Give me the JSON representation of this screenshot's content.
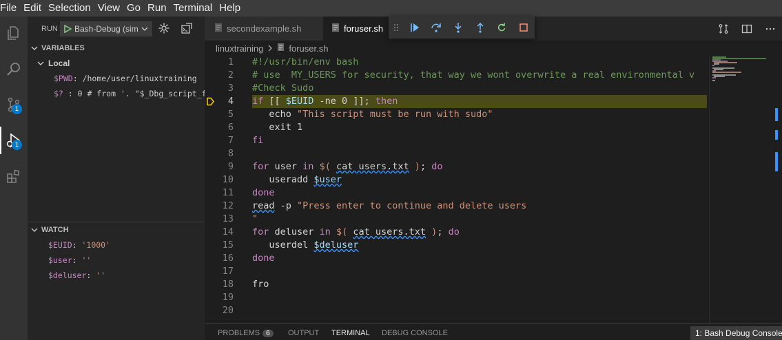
{
  "menu": [
    "File",
    "Edit",
    "Selection",
    "View",
    "Go",
    "Run",
    "Terminal",
    "Help"
  ],
  "activity": {
    "scm_badge": "1",
    "debug_badge": "1"
  },
  "run": {
    "label": "RUN",
    "config": "Bash-Debug (simp"
  },
  "variables": {
    "header": "VARIABLES",
    "scope": "Local",
    "items": [
      {
        "name": "$PWD",
        "value": "/home/user/linuxtraining"
      },
      {
        "name": "$?",
        "value": "0 # from '. \"$_Dbg_script_f"
      }
    ]
  },
  "watch": {
    "header": "WATCH",
    "items": [
      {
        "name": "$EUID",
        "value": "'1000'"
      },
      {
        "name": "$user",
        "value": "''"
      },
      {
        "name": "$deluser",
        "value": "''"
      }
    ]
  },
  "tabs": [
    {
      "label": "secondexample.sh",
      "active": false
    },
    {
      "label": "foruser.sh",
      "active": true
    }
  ],
  "breadcrumb": {
    "folder": "linuxtraining",
    "file": "foruser.sh"
  },
  "editor": {
    "current_line": 4,
    "line_numbers": [
      "1",
      "2",
      "3",
      "4",
      "5",
      "6",
      "7",
      "8",
      "9",
      "10",
      "11",
      "12",
      "13",
      "14",
      "15",
      "16",
      "17",
      "18",
      "19",
      "20"
    ]
  },
  "panel": {
    "tabs": [
      "PROBLEMS",
      "OUTPUT",
      "TERMINAL",
      "DEBUG CONSOLE"
    ],
    "problems_count": "6",
    "active_tab": "TERMINAL",
    "terminal_select": "1: Bash Debug Console"
  },
  "colors": {
    "accent": "#007acc",
    "highlight_line": "#4b4b18",
    "debug_green": "#89d185",
    "debug_blue": "#75beff",
    "stop_red": "#f48771"
  }
}
